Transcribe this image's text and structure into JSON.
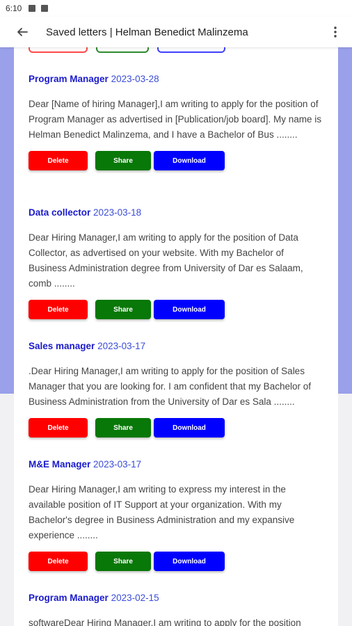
{
  "status_bar": {
    "time": "6:10"
  },
  "app_bar": {
    "title": "Saved letters | Helman Benedict Malinzema"
  },
  "buttons": {
    "delete_label": "Delete",
    "share_label": "Share",
    "download_label": "Download"
  },
  "colors": {
    "delete": "#ff0000",
    "share": "#087808",
    "download": "#0000ff",
    "title": "#1a1acb",
    "band": "#9aa0ea"
  },
  "letters": [
    {
      "title": "Program Manager",
      "date": "2023-03-28",
      "body": "Dear [Name of hiring Manager],I am writing to apply for the position of Program Manager as advertised in [Publication/job board]. My name is Helman Benedict Malinzema, and I have a Bachelor of Bus ........"
    },
    {
      "title": "Data collector",
      "date": "2023-03-18",
      "body": "Dear Hiring Manager,I am writing to apply for the position of Data Collector, as advertised on your website. With my Bachelor of Business Administration degree from University of Dar es Salaam, comb ........"
    },
    {
      "title": "Sales manager",
      "date": "2023-03-17",
      "body": ".Dear Hiring Manager,I am writing to apply for the position of Sales Manager that you are looking for. I am confident that my Bachelor of Business Administration from the University of Dar es Sala ........"
    },
    {
      "title": "M&E Manager",
      "date": "2023-03-17",
      "body": "Dear Hiring Manager,I am writing to express my interest in the available position of IT Support at your organization. With my Bachelor's degree in Business Administration and my expansive experience ........"
    },
    {
      "title": "Program Manager",
      "date": "2023-02-15",
      "body": "softwareDear Hiring Manager,I am writing to apply for the position"
    }
  ]
}
